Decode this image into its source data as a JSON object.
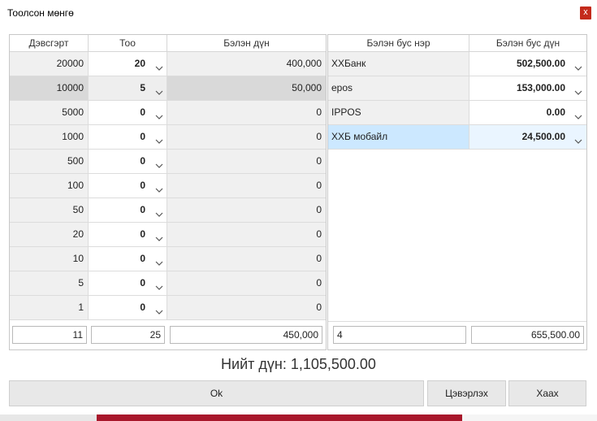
{
  "window": {
    "title": "Тоолсон мөнгө",
    "close": "x"
  },
  "cash": {
    "headers": [
      "Дэвсгэрт",
      "Тоо",
      "Бэлэн дүн"
    ],
    "rows": [
      {
        "denom": "20000",
        "count": "20",
        "amount": "400,000"
      },
      {
        "denom": "10000",
        "count": "5",
        "amount": "50,000"
      },
      {
        "denom": "5000",
        "count": "0",
        "amount": "0"
      },
      {
        "denom": "1000",
        "count": "0",
        "amount": "0"
      },
      {
        "denom": "500",
        "count": "0",
        "amount": "0"
      },
      {
        "denom": "100",
        "count": "0",
        "amount": "0"
      },
      {
        "denom": "50",
        "count": "0",
        "amount": "0"
      },
      {
        "denom": "20",
        "count": "0",
        "amount": "0"
      },
      {
        "denom": "10",
        "count": "0",
        "amount": "0"
      },
      {
        "denom": "5",
        "count": "0",
        "amount": "0"
      },
      {
        "denom": "1",
        "count": "0",
        "amount": "0"
      }
    ],
    "selected_row": 1,
    "totals": {
      "denom_count": "11",
      "count": "25",
      "amount": "450,000"
    }
  },
  "noncash": {
    "headers": [
      "Бэлэн бус нэр",
      "Бэлэн бус дүн"
    ],
    "rows": [
      {
        "name": "ХХБанк",
        "amount": "502,500.00"
      },
      {
        "name": "epos",
        "amount": "153,000.00"
      },
      {
        "name": "IPPOS",
        "amount": "0.00"
      },
      {
        "name": "ХХБ мобайл",
        "amount": "24,500.00"
      }
    ],
    "highlighted_row": 3,
    "totals": {
      "count": "4",
      "amount": "655,500.00"
    }
  },
  "total_label": "Нийт дүн: 1,105,500.00",
  "buttons": {
    "ok": "Ok",
    "clear": "Цэвэрлэх",
    "close": "Хаах"
  },
  "icons": {
    "dropdown": "chevron-down-icon"
  }
}
